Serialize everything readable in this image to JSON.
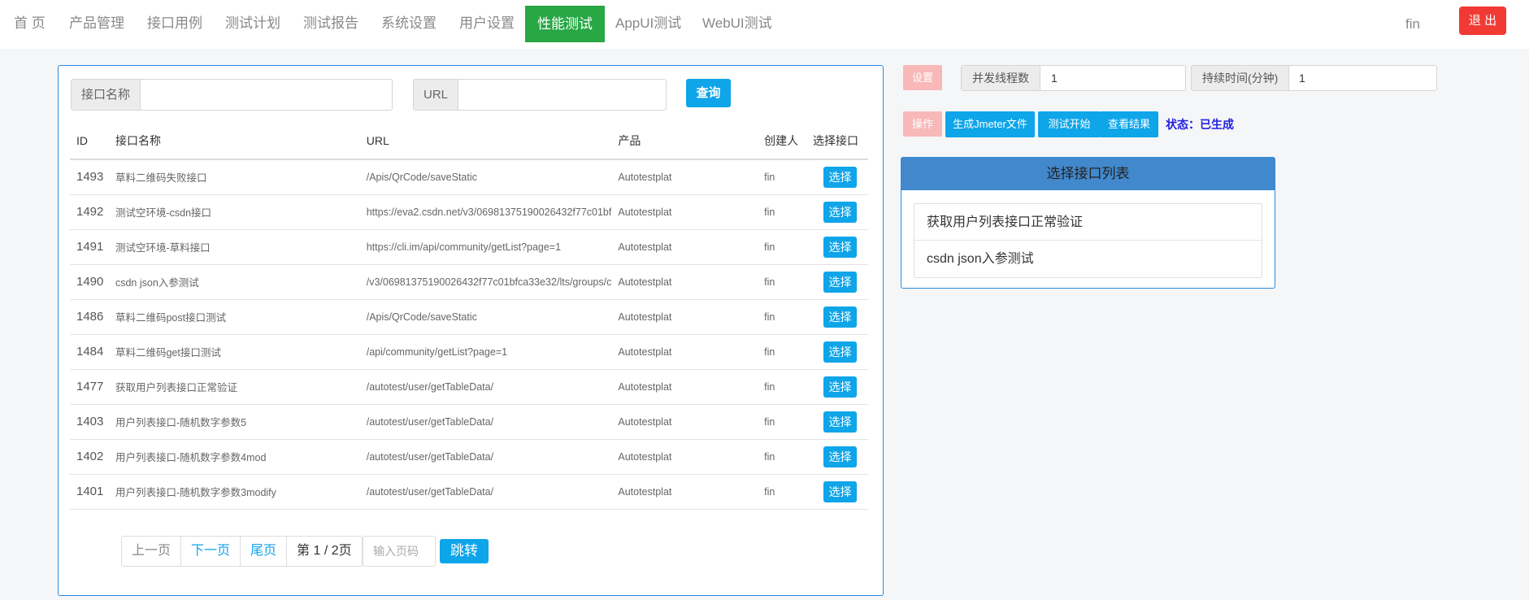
{
  "nav": {
    "items": [
      {
        "label": "首 页",
        "key": "home"
      },
      {
        "label": "产品管理",
        "key": "product"
      },
      {
        "label": "接口用例",
        "key": "api-cases"
      },
      {
        "label": "测试计划",
        "key": "plans"
      },
      {
        "label": "测试报告",
        "key": "reports"
      },
      {
        "label": "系统设置",
        "key": "system"
      },
      {
        "label": "用户设置",
        "key": "users"
      },
      {
        "label": "性能测试",
        "key": "perf"
      },
      {
        "label": "AppUI测试",
        "key": "appui"
      },
      {
        "label": "WebUI测试",
        "key": "webui"
      }
    ],
    "user": "fin",
    "logout": "退 出"
  },
  "search": {
    "name_label": "接口名称",
    "name_value": "",
    "url_label": "URL",
    "url_value": "",
    "query_label": "查询"
  },
  "table": {
    "headers": [
      "ID",
      "接口名称",
      "URL",
      "产品",
      "创建人",
      "选择接口"
    ],
    "rows": [
      {
        "id": "1493",
        "name": "草料二维码失败接口",
        "url": "/Apis/QrCode/saveStatic",
        "product": "Autotestplat",
        "creator": "fin",
        "action": "选择"
      },
      {
        "id": "1492",
        "name": "测试空环境-csdn接口",
        "url": "https://eva2.csdn.net/v3/06981375190026432f77c01bf",
        "product": "Autotestplat",
        "creator": "fin",
        "action": "选择"
      },
      {
        "id": "1491",
        "name": "测试空环境-草料接口",
        "url": "https://cli.im/api/community/getList?page=1",
        "product": "Autotestplat",
        "creator": "fin",
        "action": "选择"
      },
      {
        "id": "1490",
        "name": "csdn json入参测试",
        "url": "/v3/06981375190026432f77c01bfca33e32/lts/groups/c",
        "product": "Autotestplat",
        "creator": "fin",
        "action": "选择"
      },
      {
        "id": "1486",
        "name": "草料二维码post接口测试",
        "url": "/Apis/QrCode/saveStatic",
        "product": "Autotestplat",
        "creator": "fin",
        "action": "选择"
      },
      {
        "id": "1484",
        "name": "草料二维码get接口测试",
        "url": "/api/community/getList?page=1",
        "product": "Autotestplat",
        "creator": "fin",
        "action": "选择"
      },
      {
        "id": "1477",
        "name": "获取用户列表接口正常验证",
        "url": "/autotest/user/getTableData/",
        "product": "Autotestplat",
        "creator": "fin",
        "action": "选择"
      },
      {
        "id": "1403",
        "name": "用户列表接口-随机数字参数5",
        "url": "/autotest/user/getTableData/",
        "product": "Autotestplat",
        "creator": "fin",
        "action": "选择"
      },
      {
        "id": "1402",
        "name": "用户列表接口-随机数字参数4mod",
        "url": "/autotest/user/getTableData/",
        "product": "Autotestplat",
        "creator": "fin",
        "action": "选择"
      },
      {
        "id": "1401",
        "name": "用户列表接口-随机数字参数3modify",
        "url": "/autotest/user/getTableData/",
        "product": "Autotestplat",
        "creator": "fin",
        "action": "选择"
      }
    ]
  },
  "pager": {
    "prev": "上一页",
    "next": "下一页",
    "last": "尾页",
    "info": "第 1 / 2页",
    "input_placeholder": "输入页码",
    "jump": "跳转"
  },
  "settings": {
    "settings_badge": "设置",
    "threads_label": "并发线程数",
    "threads_value": "1",
    "duration_label": "持续时间(分钟)",
    "duration_value": "1",
    "ops_badge": "操作",
    "gen_jmeter": "生成Jmeter文件",
    "start_test": "测试开始",
    "view_result": "查看结果",
    "status": "状态：已生成"
  },
  "selected_list": {
    "title": "选择接口列表",
    "items": [
      "获取用户列表接口正常验证",
      "csdn json入参测试"
    ]
  },
  "colors": {
    "accent": "#0ea5e9",
    "active_nav": "#28a745",
    "logout": "#f23a35",
    "panel_border": "#2a8be0",
    "list_header": "#4288cc"
  }
}
